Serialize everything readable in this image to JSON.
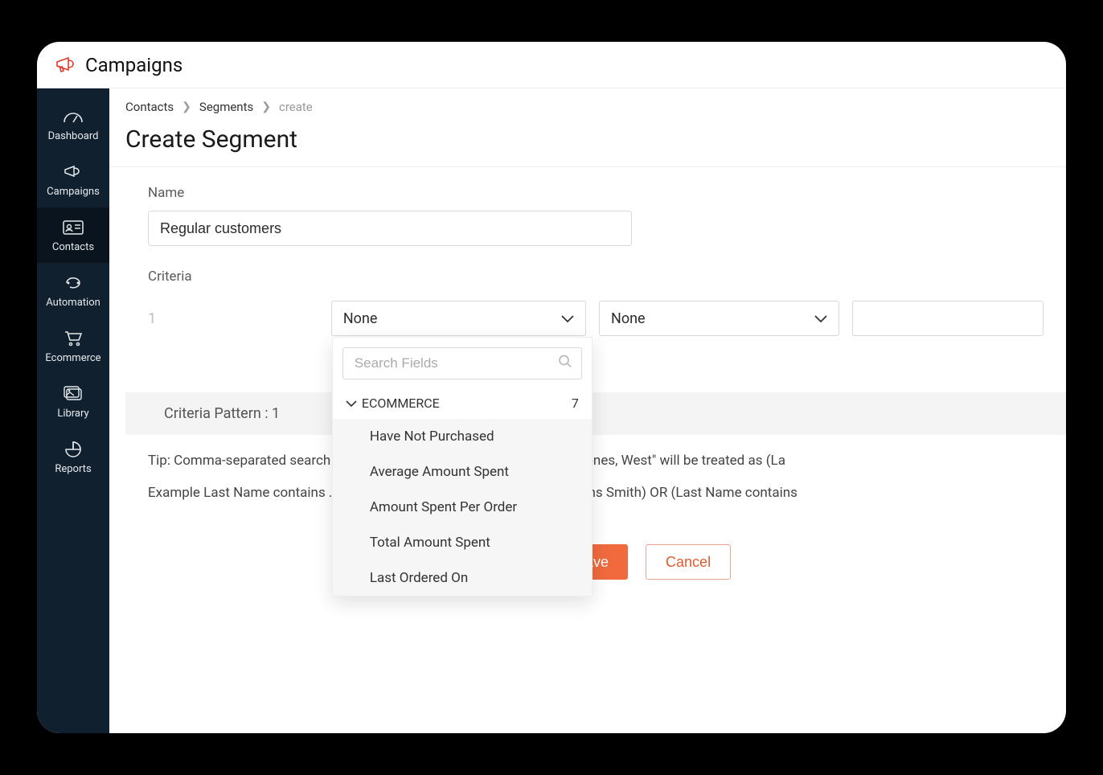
{
  "brand": {
    "name": "Campaigns"
  },
  "sidebar": {
    "items": [
      {
        "label": "Dashboard"
      },
      {
        "label": "Campaigns"
      },
      {
        "label": "Contacts"
      },
      {
        "label": "Automation"
      },
      {
        "label": "Ecommerce"
      },
      {
        "label": "Library"
      },
      {
        "label": "Reports"
      }
    ],
    "active_index": 2
  },
  "breadcrumb": {
    "a": "Contacts",
    "b": "Segments",
    "c": "create"
  },
  "page": {
    "title": "Create Segment"
  },
  "form": {
    "name_label": "Name",
    "name_value": "Regular customers",
    "criteria_label": "Criteria",
    "row_number": "1",
    "select1_value": "None",
    "select2_value": "None",
    "dropdown": {
      "search_placeholder": "Search Fields",
      "group_label": "ECOMMERCE",
      "group_count": "7",
      "items": [
        "Have Not Purchased",
        "Average Amount Spent",
        "Amount Spent Per Order",
        "Total Amount Spent",
        "Last Ordered On"
      ]
    },
    "pattern_text": "Criteria Pattern : 1",
    "tip_text": "Tip: Comma-separated search                                                                             as 'OR' criteria. Ex: \"Last Name contains Jones, West\" will be treated as (La",
    "example_text": "Example  Last Name contains .                                                                           ne contains Jones) OR (Last Name contains Smith) OR (Last Name contains",
    "save_label": "ave",
    "cancel_label": "Cancel"
  }
}
